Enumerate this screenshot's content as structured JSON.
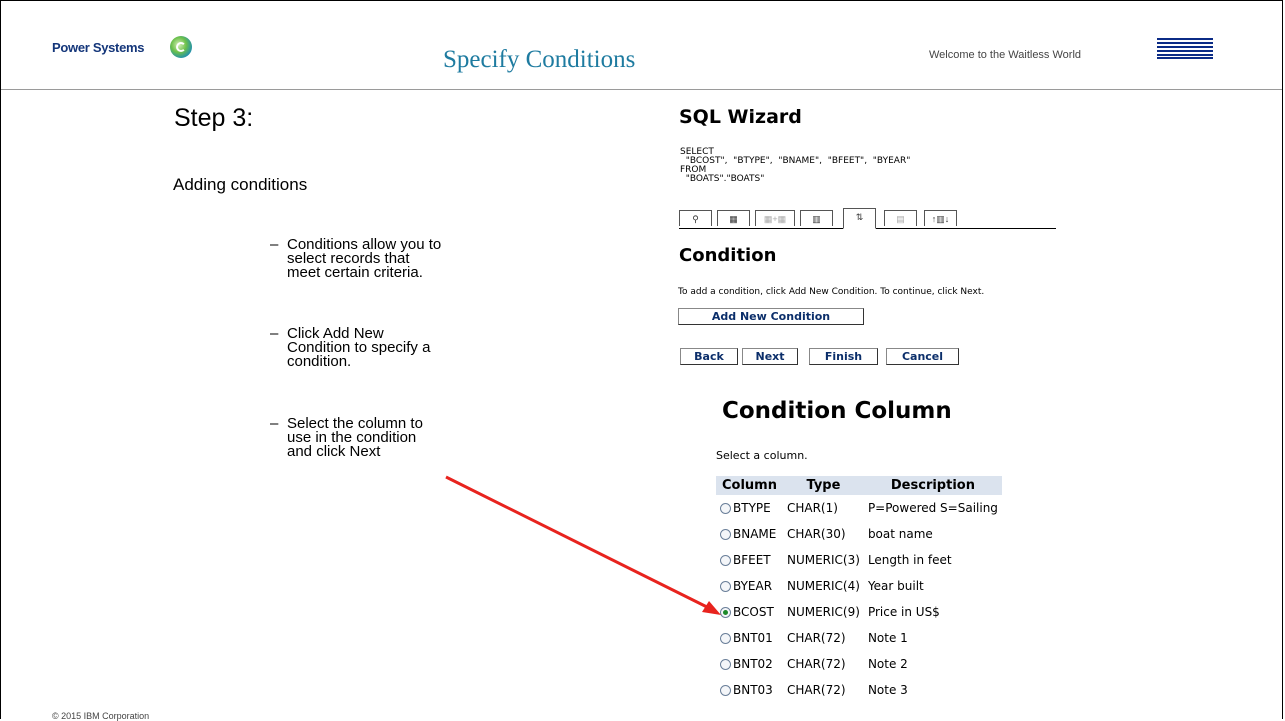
{
  "header": {
    "logo_text": "Power Systems",
    "title": "Specify Conditions",
    "tagline": "Welcome to the Waitless World",
    "brand": "IBM",
    "brand_color": "#0b2b86",
    "title_color": "#1e7ba0"
  },
  "left": {
    "step": "Step 3:",
    "subtitle": "Adding conditions",
    "bullets": [
      {
        "dash": "–",
        "lines": [
          "Conditions allow you to",
          "select records that",
          "meet certain criteria."
        ]
      },
      {
        "dash": "–",
        "lines": [
          "Click Add New",
          "Condition to specify a",
          "condition."
        ]
      },
      {
        "dash": "–",
        "lines": [
          "Select the column to",
          "use in the condition",
          "and click Next"
        ]
      }
    ]
  },
  "footer": {
    "copyright": "© 2015 IBM Corporation"
  },
  "wizard": {
    "title": "SQL Wizard",
    "sql_lines": [
      "SELECT",
      "  \"BCOST\",  \"BTYPE\",  \"BNAME\",  \"BFEET\",  \"BYEAR\"",
      "FROM",
      "  \"BOATS\".\"BOATS\""
    ],
    "tabs": [
      {
        "icon": "speech-bubble-icon",
        "glyph": "⚲"
      },
      {
        "icon": "table-icon",
        "glyph": "▦"
      },
      {
        "icon": "join-tables-icon",
        "glyph": "▦+▦"
      },
      {
        "icon": "columns-icon",
        "glyph": "▥"
      },
      {
        "icon": "condition-icon",
        "glyph": "⇅"
      },
      {
        "icon": "summary-icon",
        "glyph": "▤"
      },
      {
        "icon": "sort-icon",
        "glyph": "↑▥↓"
      }
    ],
    "condition_title": "Condition",
    "condition_instruction": "To add a condition, click Add New Condition. To continue, click Next.",
    "add_button": "Add New Condition",
    "nav_buttons": {
      "back": "Back",
      "next": "Next",
      "finish": "Finish",
      "cancel": "Cancel"
    }
  },
  "condition_column": {
    "title": "Condition Column",
    "instruction": "Select a column.",
    "headers": [
      "Column",
      "Type",
      "Description"
    ],
    "rows": [
      {
        "column": "BTYPE",
        "type": "CHAR(1)",
        "description": "P=Powered S=Sailing",
        "selected": false
      },
      {
        "column": "BNAME",
        "type": "CHAR(30)",
        "description": "boat name",
        "selected": false
      },
      {
        "column": "BFEET",
        "type": "NUMERIC(3)",
        "description": "Length in feet",
        "selected": false
      },
      {
        "column": "BYEAR",
        "type": "NUMERIC(4)",
        "description": "Year built",
        "selected": false
      },
      {
        "column": "BCOST",
        "type": "NUMERIC(9)",
        "description": "Price in US$",
        "selected": true
      },
      {
        "column": "BNT01",
        "type": "CHAR(72)",
        "description": "Note 1",
        "selected": false
      },
      {
        "column": "BNT02",
        "type": "CHAR(72)",
        "description": "Note 2",
        "selected": false
      },
      {
        "column": "BNT03",
        "type": "CHAR(72)",
        "description": "Note 3",
        "selected": false
      }
    ],
    "header_bg": "#dbe3ee",
    "radio_selected_color": "#1d8a2a"
  },
  "annotation": {
    "arrow_color": "#e8231e"
  }
}
